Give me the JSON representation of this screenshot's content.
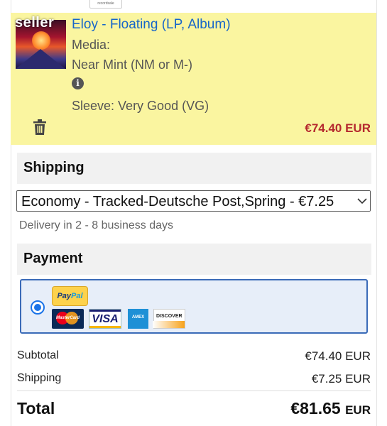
{
  "item": {
    "cover_watermark": "seller",
    "title": "Eloy - Floating (LP, Album)",
    "media_label": "Media:",
    "media_condition": "Near Mint (NM or M-)",
    "sleeve": "Sleeve: Very Good (VG)",
    "price": "€74.40 EUR",
    "icons": {
      "info": "info-icon",
      "delete": "trash-icon"
    }
  },
  "shipping": {
    "heading": "Shipping",
    "selected_option": "Economy - Tracked-Deutsche Post,Spring - €7.25",
    "delivery_note": "Delivery in 2 - 8 business days"
  },
  "payment": {
    "heading": "Payment",
    "method_selected": true,
    "logos": [
      "PayPal",
      "MasterCard",
      "VISA",
      "AMEX",
      "DISCOVER"
    ]
  },
  "summary": {
    "subtotal_label": "Subtotal",
    "subtotal_value": "€74.40 EUR",
    "shipping_label": "Shipping",
    "shipping_value": "€7.25 EUR",
    "total_label": "Total",
    "total_amount": "€81.65",
    "total_currency": "EUR"
  },
  "colors": {
    "item_highlight": "#faf5a0",
    "link_blue": "#1766c9",
    "price_red": "#b5292f",
    "payment_border": "#3b6bb8"
  }
}
